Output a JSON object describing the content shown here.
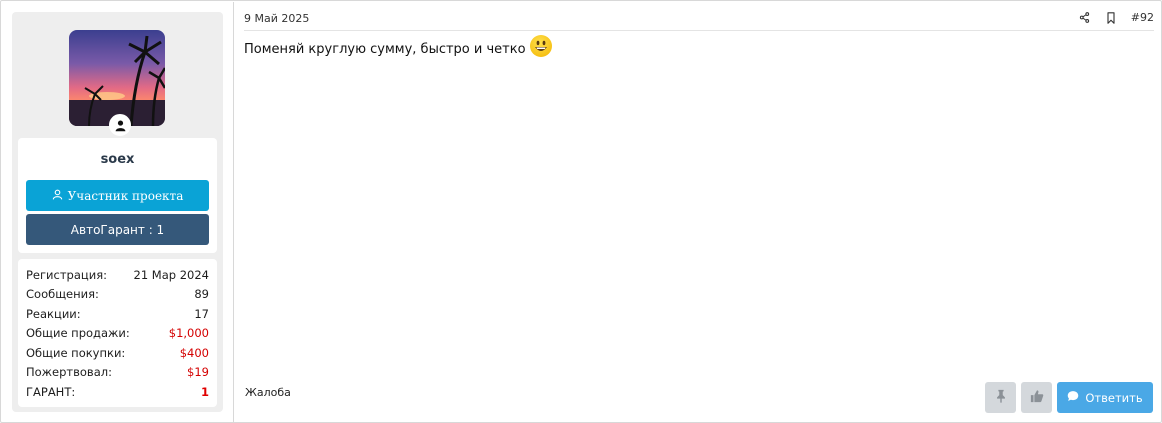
{
  "user": {
    "name": "soex",
    "role_label": "Участник проекта",
    "guarantee_label": "АвтоГарант : 1",
    "stats": [
      {
        "label": "Регистрация:",
        "value": "21 Мар 2024",
        "style": "normal"
      },
      {
        "label": "Сообщения:",
        "value": "89",
        "style": "normal"
      },
      {
        "label": "Реакции:",
        "value": "17",
        "style": "normal"
      },
      {
        "label": "Общие продажи:",
        "value": "$1,000",
        "style": "red"
      },
      {
        "label": "Общие покупки:",
        "value": "$400",
        "style": "red"
      },
      {
        "label": "Пожертвовал:",
        "value": "$19",
        "style": "red"
      },
      {
        "label": "ГАРАНТ:",
        "value": "1",
        "style": "red-bold"
      }
    ]
  },
  "post": {
    "date": "9 Май 2025",
    "number": "#92",
    "message": "Поменяй круглую сумму, быстро и четко",
    "report_label": "Жалоба",
    "reply_label": "Ответить"
  },
  "colors": {
    "role_button": "#0aa3d6",
    "guarantee_button": "#35587a",
    "reply_button": "#4aa8e6",
    "stat_red": "#d40000"
  },
  "icons": {
    "role": "user-outline-icon",
    "online": "user-icon",
    "share": "share-icon",
    "bookmark": "bookmark-icon",
    "emoji": "grinning-face-emoji",
    "pin": "pin-icon",
    "like": "thumbs-up-icon",
    "reply": "chat-bubble-icon"
  }
}
